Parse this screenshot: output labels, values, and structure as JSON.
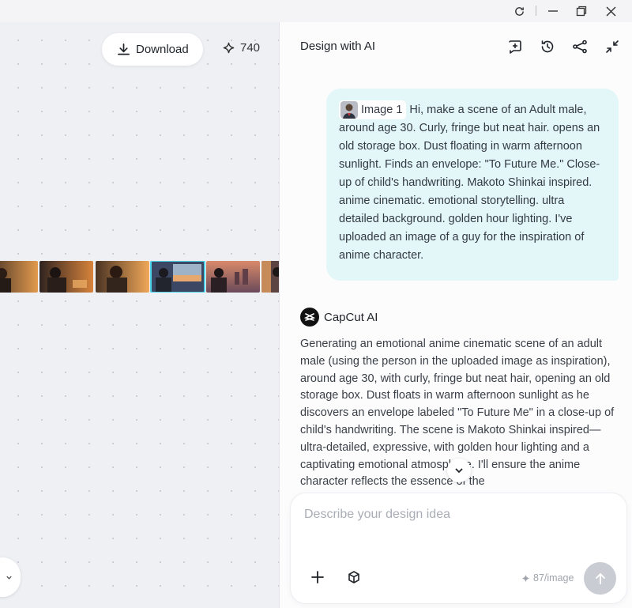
{
  "window": {
    "controls": [
      "refresh-icon",
      "minimize-icon",
      "restore-icon",
      "close-icon"
    ]
  },
  "canvas": {
    "download_label": "Download",
    "credits": "740",
    "thumbnails": [
      {
        "id": 1,
        "tone": "#c97a3c"
      },
      {
        "id": 2,
        "tone": "#b5652c"
      },
      {
        "id": 3,
        "tone": "#d08a44"
      },
      {
        "id": 4,
        "tone": "#a6564a"
      },
      {
        "id": 5,
        "tone": "#4d5b78",
        "selected": true
      },
      {
        "id": 6,
        "tone": "#c97654"
      },
      {
        "id": 7,
        "tone": "#6b4c48"
      }
    ]
  },
  "panel": {
    "title": "Design with AI",
    "header_icons": [
      "new-chat-icon",
      "history-icon",
      "share-icon",
      "collapse-icon"
    ],
    "user_message": {
      "image_chip_label": "Image 1",
      "text": "Hi, make a scene of an Adult male, around age 30. Curly, fringe but neat hair. opens an old storage box. Dust floating in warm afternoon sunlight. Finds an envelope: \"To Future Me.\" Close-up of child's handwriting. Makoto Shinkai inspired. anime cinematic. emotional storytelling. ultra detailed background. golden hour lighting. I've uploaded an image of a guy for the inspiration of anime character."
    },
    "ai_message": {
      "name": "CapCut AI",
      "text": "Generating an emotional anime cinematic scene of an adult male (using the person in the uploaded image as inspiration), around age 30, with curly, fringe but neat hair, opening an old storage box. Dust floats in warm afternoon sunlight as he discovers an envelope labeled \"To Future Me\" in a close-up of child's handwriting. The scene is Makoto Shinkai inspired—ultra-detailed, expressive, with golden hour lighting and a captivating emotional atmosphere. I'll ensure the anime character reflects the essence of the"
    },
    "composer": {
      "placeholder": "Describe your design idea",
      "cost": "87/image"
    }
  },
  "colors": {
    "accent_bubble": "#e3f6f8",
    "selected_thumb": "#4bd0e6"
  }
}
